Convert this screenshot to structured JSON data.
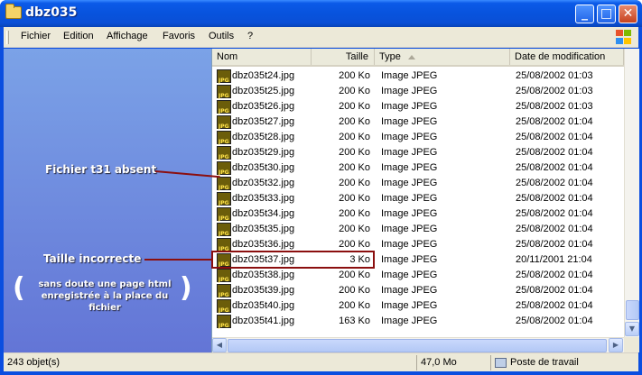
{
  "window": {
    "title": "dbz035"
  },
  "title_buttons": {
    "minimize": "_",
    "maximize": "□",
    "close": "✕"
  },
  "menu": [
    "Fichier",
    "Edition",
    "Affichage",
    "Favoris",
    "Outils",
    "?"
  ],
  "columns": {
    "name": "Nom",
    "size": "Taille",
    "type": "Type",
    "date": "Date de modification"
  },
  "files": [
    {
      "name": "dbz035t24.jpg",
      "size": "200 Ko",
      "type": "Image JPEG",
      "date": "25/08/2002 01:03"
    },
    {
      "name": "dbz035t25.jpg",
      "size": "200 Ko",
      "type": "Image JPEG",
      "date": "25/08/2002 01:03"
    },
    {
      "name": "dbz035t26.jpg",
      "size": "200 Ko",
      "type": "Image JPEG",
      "date": "25/08/2002 01:03"
    },
    {
      "name": "dbz035t27.jpg",
      "size": "200 Ko",
      "type": "Image JPEG",
      "date": "25/08/2002 01:04"
    },
    {
      "name": "dbz035t28.jpg",
      "size": "200 Ko",
      "type": "Image JPEG",
      "date": "25/08/2002 01:04"
    },
    {
      "name": "dbz035t29.jpg",
      "size": "200 Ko",
      "type": "Image JPEG",
      "date": "25/08/2002 01:04"
    },
    {
      "name": "dbz035t30.jpg",
      "size": "200 Ko",
      "type": "Image JPEG",
      "date": "25/08/2002 01:04"
    },
    {
      "name": "dbz035t32.jpg",
      "size": "200 Ko",
      "type": "Image JPEG",
      "date": "25/08/2002 01:04"
    },
    {
      "name": "dbz035t33.jpg",
      "size": "200 Ko",
      "type": "Image JPEG",
      "date": "25/08/2002 01:04"
    },
    {
      "name": "dbz035t34.jpg",
      "size": "200 Ko",
      "type": "Image JPEG",
      "date": "25/08/2002 01:04"
    },
    {
      "name": "dbz035t35.jpg",
      "size": "200 Ko",
      "type": "Image JPEG",
      "date": "25/08/2002 01:04"
    },
    {
      "name": "dbz035t36.jpg",
      "size": "200 Ko",
      "type": "Image JPEG",
      "date": "25/08/2002 01:04"
    },
    {
      "name": "dbz035t37.jpg",
      "size": "3 Ko",
      "type": "Image JPEG",
      "date": "20/11/2001 21:04"
    },
    {
      "name": "dbz035t38.jpg",
      "size": "200 Ko",
      "type": "Image JPEG",
      "date": "25/08/2002 01:04"
    },
    {
      "name": "dbz035t39.jpg",
      "size": "200 Ko",
      "type": "Image JPEG",
      "date": "25/08/2002 01:04"
    },
    {
      "name": "dbz035t40.jpg",
      "size": "200 Ko",
      "type": "Image JPEG",
      "date": "25/08/2002 01:04"
    },
    {
      "name": "dbz035t41.jpg",
      "size": "163 Ko",
      "type": "Image JPEG",
      "date": "25/08/2002 01:04"
    }
  ],
  "annotations": {
    "missing": "Fichier t31 absent",
    "wrong_size": "Taille incorrecte",
    "note_line1": "sans doute une page html",
    "note_line2": "enregistrée à la place du fichier",
    "paren_left": "(",
    "paren_right": ")"
  },
  "status": {
    "objects": "243 objet(s)",
    "size": "47,0 Mo",
    "location": "Poste de travail"
  },
  "colors": {
    "title_blue": "#0a4ee0",
    "annotation_red": "#8b0f0f",
    "pane_blue": "#6f8ee0"
  }
}
